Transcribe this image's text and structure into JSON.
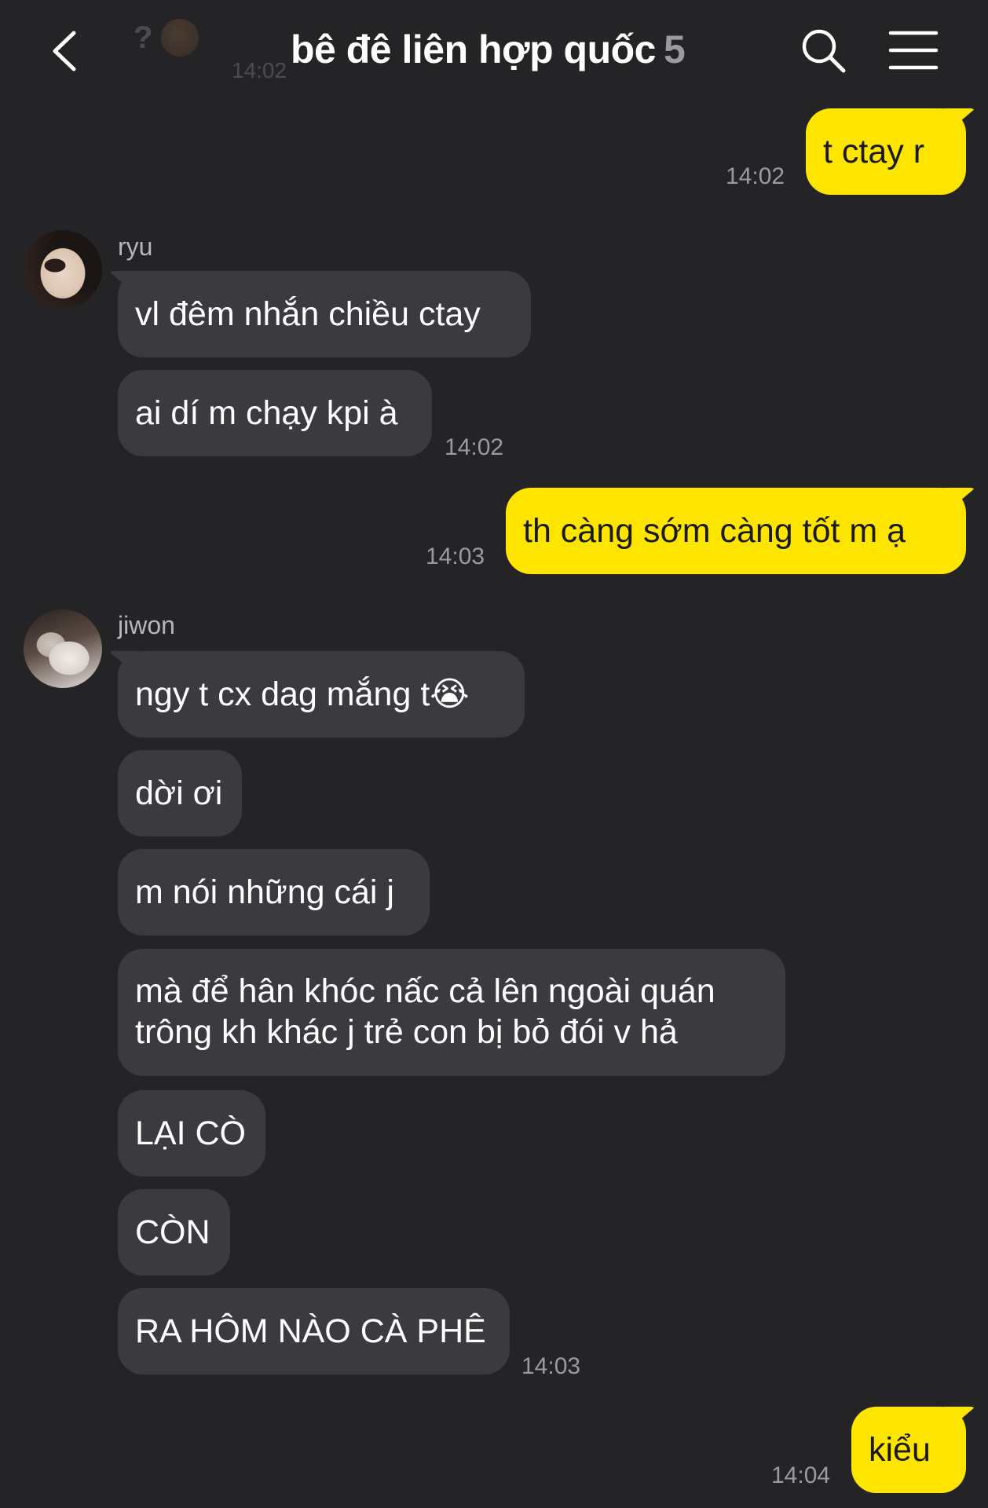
{
  "header": {
    "back_label": "Back",
    "peek_question": "?",
    "peek_time": "14:02",
    "title": "bê đê liên hợp quốc",
    "member_count": "5",
    "search_label": "Search",
    "menu_label": "Menu"
  },
  "colors": {
    "background": "#242427",
    "outgoing_bubble": "#fee500",
    "incoming_bubble": "#3a3a3f",
    "timestamp": "#9a9aa0"
  },
  "messages": [
    {
      "direction": "outgoing",
      "text": "t ctay r",
      "time": "14:02"
    },
    {
      "direction": "incoming",
      "sender": "ryu",
      "texts": [
        "vl đêm nhắn chiều ctay",
        "ai dí m chạy kpi à"
      ],
      "time": "14:02"
    },
    {
      "direction": "outgoing",
      "text": "th càng sớm càng tốt m ạ",
      "time": "14:03"
    },
    {
      "direction": "incoming",
      "sender": "jiwon",
      "texts": [
        "ngy t cx dag mắng t😭",
        "dời ơi",
        "m nói những cái j",
        "mà để hân khóc nấc cả lên ngoài quán",
        "trông kh khác j trẻ con bị bỏ đói v hả",
        "LẠI CÒ",
        "CÒN",
        "RA HÔM NÀO CÀ PHÊ"
      ],
      "time": "14:03"
    },
    {
      "direction": "outgoing",
      "text": "kiểu",
      "time": "14:04"
    }
  ],
  "icons": {
    "back": "chevron-left-icon",
    "search": "search-icon",
    "menu": "hamburger-menu-icon"
  }
}
